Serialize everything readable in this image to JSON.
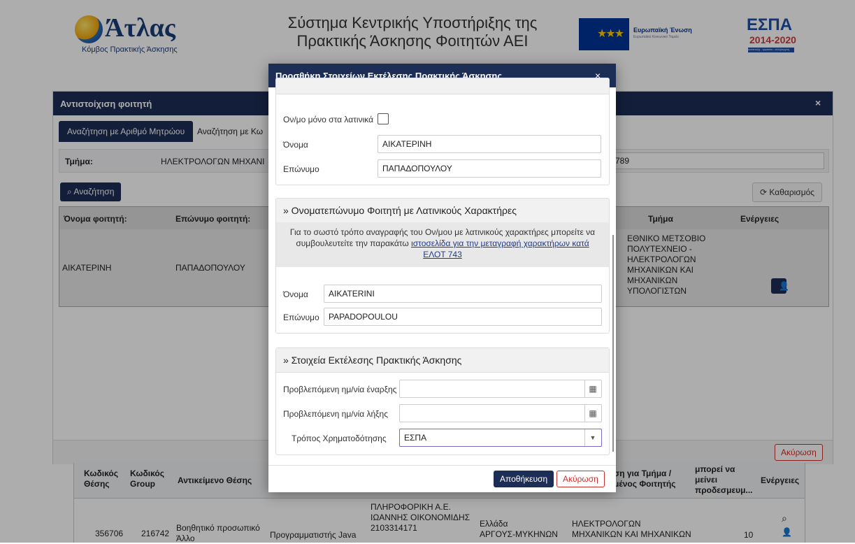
{
  "header": {
    "logo_word": "Άτλας",
    "logo_subtitle": "Κόμβος Πρακτικής Άσκησης",
    "title_line1": "Σύστημα Κεντρικής Υποστήριξης της",
    "title_line2": "Πρακτικής Άσκησης Φοιτητών ΑΕΙ",
    "eu_label": "Ευρωπαϊκή Ένωση",
    "eu_small": "Ευρωπαϊκό Κοινωνικό Ταμείο",
    "espa_label": "ΕΣΠΑ",
    "espa_years": "2014-2020",
    "espa_tagline": "ανάπτυξη - εργασία - αλληλεγγύη"
  },
  "background_dialog": {
    "title": "Αντιστοίχιση φοιτητή",
    "close": "×",
    "tab_active": "Αναζήτηση με Αριθμό Μητρώου",
    "tab_other": "Αναζήτηση με Κω",
    "dept_label": "Τμήμα:",
    "dept_value": "ΗΛΕΚΤΡΟΛΟΓΩΝ ΜΗΧΑΝΙ",
    "field_partial": "789",
    "search_button": "Αναζήτηση",
    "clear_button": "Καθαρισμός",
    "table_headers": [
      "Όνομα φοιτητή:",
      "Επώνυμο φοιτητή:",
      "Τμήμα",
      "Ενέργειες"
    ],
    "row": {
      "first_name": "ΑΙΚΑΤΕΡΙΝΗ",
      "last_name": "ΠΑΠΑΔΟΠΟΥΛΟΥ",
      "dept_lines": [
        "ΕΘΝΙΚΟ ΜΕΤΣΟΒΙΟ",
        "ΠΟΛΥΤΕΧΝΕΙΟ -",
        "ΗΛΕΚΤΡΟΛΟΓΩΝ",
        "ΜΗΧΑΝΙΚΩΝ ΚΑΙ",
        "ΜΗΧΑΝΙΚΩΝ",
        "ΥΠΟΛΟΓΙΣΤΩΝ"
      ]
    },
    "cancel_button": "Ακύρωση"
  },
  "positions_table": {
    "headers": {
      "code": [
        "Κωδικός",
        "Θέσης"
      ],
      "group": [
        "Κωδικός",
        "Group"
      ],
      "object": "Αντικείμενο Θέσης",
      "dept": [
        "ση για Τμήμα /",
        "μένος Φοιτητής"
      ],
      "remaining": [
        "μπορεί να",
        "μείνει",
        "προδεσμευμ..."
      ],
      "actions": "Ενέργειες"
    },
    "row": {
      "code": "356706",
      "group": "216742",
      "object_lines": [
        "Βοηθητικό προσωπικό",
        "Άλλο"
      ],
      "title": "Προγραμματιστής Java",
      "company_lines": [
        "ΠΛΗΡΟΦΟΡΙΚΗ Α.Ε.",
        "ΙΩΑΝΝΗΣ ΟΙΚΟΝΟΜΙΔΗΣ",
        "2103314171"
      ],
      "location_lines": [
        "Ελλάδα",
        "ΑΡΓΟΥΣ-ΜΥΚΗΝΩΝ"
      ],
      "dept_lines": [
        "ΗΛΕΚΤΡΟΛΟΓΩΝ",
        "ΜΗΧΑΝΙΚΩΝ ΚΑΙ ΜΗΧΑΝΙΚΩΝ"
      ],
      "remaining": "10"
    }
  },
  "modal": {
    "title": "Προσθήκη Στοιχείων Εκτέλεσης Πρακτικής Άσκησης",
    "close": "×",
    "latin_only_label": "Ον/μο μόνο στα λατινικά",
    "first_name_label": "Όνομα",
    "first_name_value": "ΑΙΚΑΤΕΡΙΝΗ",
    "last_name_label": "Επώνυμο",
    "last_name_value": "ΠΑΠΑΔΟΠΟΥΛΟΥ",
    "latin_section_title": "» Ονοματεπώνυμο Φοιτητή με Λατινικούς Χαρακτήρες",
    "info_text_1": "Για το σωστό τρόπο αναγραφής του Ον/μου με λατινικούς χαρακτήρες μπορείτε να",
    "info_text_2": "συμβουλευτείτε την παρακάτω",
    "info_link_1": "ιστοσελίδα για την μεταγραφή χαρακτήρων κατά",
    "info_link_2": "ΕΛΟΤ 743",
    "latin_first_label": "Όνομα",
    "latin_first_value": "AIKATERINI",
    "latin_last_label": "Επώνυμο",
    "latin_last_value": "PAPADOPOULOU",
    "exec_section_title": "» Στοιχεία Εκτέλεσης Πρακτικής Άσκησης",
    "start_date_label": "Προβλεπόμενη ημ/νία έναρξης",
    "end_date_label": "Προβλεπόμενη ημ/νία λήξης",
    "funding_label": "Τρόπος Χρηματοδότησης",
    "funding_value": "ΕΣΠΑ",
    "save_button": "Αποθήκευση",
    "cancel_button": "Ακύρωση"
  }
}
